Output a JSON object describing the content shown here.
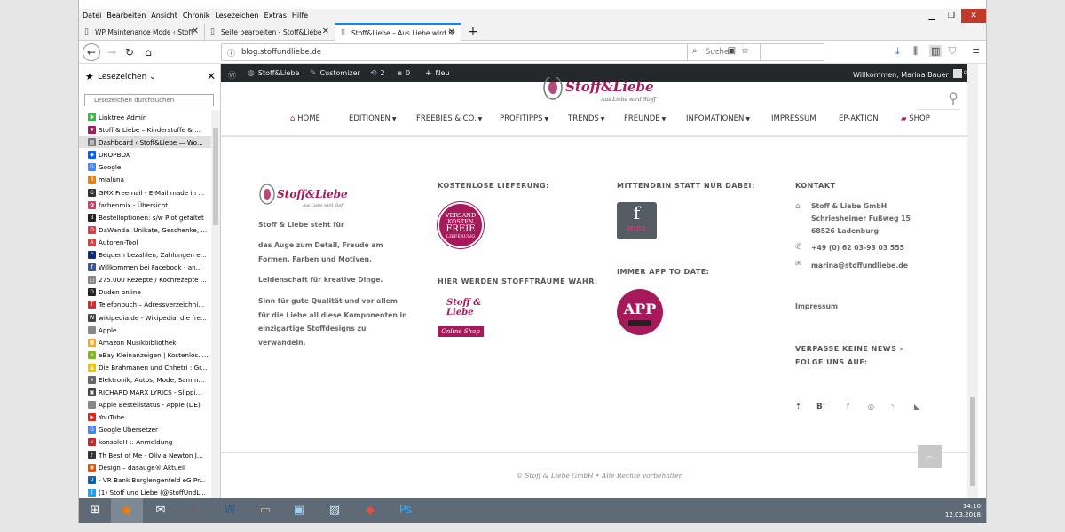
{
  "browser": {
    "menu": [
      "Datei",
      "Bearbeiten",
      "Ansicht",
      "Chronik",
      "Lesezeichen",
      "Extras",
      "Hilfe"
    ],
    "tabs": [
      {
        "label": "WP Maintenance Mode ‹ Stoff"
      },
      {
        "label": "Seite bearbeiten ‹ Stoff&Liebe"
      },
      {
        "label": "Stoff&Liebe – Aus Liebe wird St"
      }
    ],
    "url": "blog.stoffundliebe.de",
    "search_placeholder": "Suchen"
  },
  "sidebar": {
    "title": "Lesezeichen",
    "search_placeholder": "Lesezeichen durchsuchen",
    "bookmarks": [
      {
        "label": "Linktree Admin",
        "color": "#3bb54a",
        "glyph": "✱"
      },
      {
        "label": "Stoff & Liebe – Kinderstoffe & ...",
        "color": "#a6195a",
        "glyph": "❦"
      },
      {
        "label": "Dashboard ‹ Stoff&Liebe — Wo...",
        "color": "#777777",
        "glyph": "▤"
      },
      {
        "label": "DROPBOX",
        "color": "#0061ff",
        "glyph": "◆"
      },
      {
        "label": "Google",
        "color": "#4285f4",
        "glyph": "G"
      },
      {
        "label": "mialuna",
        "color": "#f57c00",
        "glyph": "B"
      },
      {
        "label": "GMX Freemail - E-Mail made in ...",
        "color": "#333333",
        "glyph": "G"
      },
      {
        "label": "farbenmix - Übersicht",
        "color": "#d83a6d",
        "glyph": "✿"
      },
      {
        "label": "Bestelloptionen: s/w Plot gefaltet",
        "color": "#222222",
        "glyph": "B"
      },
      {
        "label": "DaWanda: Unikate, Geschenke, ...",
        "color": "#e23744",
        "glyph": "D"
      },
      {
        "label": "Autoren-Tool",
        "color": "#e53935",
        "glyph": "A"
      },
      {
        "label": "Bequem bezahlen, Zahlungen e...",
        "color": "#003087",
        "glyph": "P"
      },
      {
        "label": "Willkommen bei Facebook - an...",
        "color": "#3b5998",
        "glyph": "f"
      },
      {
        "label": "275.000 Rezepte / Kochrezepte ...",
        "color": "#888888",
        "glyph": "▢"
      },
      {
        "label": "Duden online",
        "color": "#222222",
        "glyph": "D"
      },
      {
        "label": "Telefonbuch – Adressverzeichni...",
        "color": "#d32f2f",
        "glyph": "T"
      },
      {
        "label": "wikipedia.de - Wikipedia, die fre...",
        "color": "#444444",
        "glyph": "W"
      },
      {
        "label": "Apple",
        "color": "#888888",
        "glyph": ""
      },
      {
        "label": "Amazon Musikbibliothek",
        "color": "#f5a623",
        "glyph": "▦"
      },
      {
        "label": "eBay Kleinanzeigen | Kostenlos. ...",
        "color": "#86b817",
        "glyph": "e"
      },
      {
        "label": "Die Brahmanen und Chhetri : Gr...",
        "color": "#f2c200",
        "glyph": "▲"
      },
      {
        "label": "Elektronik, Autos, Mode, Samm...",
        "color": "#666666",
        "glyph": "e"
      },
      {
        "label": "RICHARD MARX LYRICS - Slippi...",
        "color": "#444444",
        "glyph": "▣"
      },
      {
        "label": "Apple Bestellstatus - Apple (DE)",
        "color": "#888888",
        "glyph": ""
      },
      {
        "label": "YouTube",
        "color": "#e62117",
        "glyph": "▶"
      },
      {
        "label": "Google Übersetzer",
        "color": "#4285f4",
        "glyph": "G"
      },
      {
        "label": "konsoleH :: Anmeldung",
        "color": "#c62828",
        "glyph": "k"
      },
      {
        "label": "Th Best of Me - Olivia Newton J...",
        "color": "#333333",
        "glyph": "♪"
      },
      {
        "label": "Design – dasauge® Aktuell",
        "color": "#e65100",
        "glyph": "◉"
      },
      {
        "label": "- VR Bank Burglengenfeld eG Pr...",
        "color": "#0066b3",
        "glyph": "V"
      },
      {
        "label": "(1) Stoff und Liebe (@StoffUndL...",
        "color": "#1da1f2",
        "glyph": "t"
      }
    ]
  },
  "admin_bar": {
    "site": "Stoff&Liebe",
    "customizer": "Customizer",
    "updates": "2",
    "comments": "0",
    "new": "Neu",
    "welcome": "Willkommen, Marina Bauer"
  },
  "site": {
    "logo_text": "Stoff&Liebe",
    "logo_tagline": "Aus Liebe wird Stoff",
    "nav": [
      "HOME",
      "EDITIONEN",
      "FREEBIES & CO.",
      "PROFITIPPS",
      "TRENDS",
      "FREUNDE",
      "INFOMATIONEN",
      "IMPRESSUM",
      "EP-AKTION",
      "SHOP"
    ]
  },
  "footer": {
    "col1": {
      "intro": "Stoff & Liebe steht für",
      "p1": "das Auge zum Detail, Freude am Formen, Farben und Motiven.",
      "p2": "Leidenschaft für kreative Dinge.",
      "p3": "Sinn für gute Qualität und vor allem für die Liebe all diese Komponenten in einzigartige Stoffdesigns zu verwandeln."
    },
    "col2": {
      "heading1": "KOSTENLOSE LIEFERUNG:",
      "badge_lines": [
        "VERSAND",
        "KOSTEN",
        "FREIE",
        "LIEFERUNG"
      ],
      "heading2": "HIER WERDEN STOFFTRÄUME WAHR:",
      "shop_logo": "Stoff & Liebe",
      "shop_label": "Online Shop"
    },
    "col3": {
      "heading1": "MITTENDRIN STATT NUR DABEI:",
      "mnz_label": "mnz",
      "heading2": "IMMER APP TO DATE:",
      "app_label": "APP"
    },
    "col4": {
      "heading": "KONTAKT",
      "company": "Stoff & Liebe GmbH",
      "street": "Schriesheimer Fußweg 15",
      "city": "68526 Ladenburg",
      "phone": "+49 (0) 62 03-93 03 555",
      "email": "marina@stoffundliebe.de",
      "impressum": "Impressum",
      "news1": "VERPASSE KEINE NEWS –",
      "news2": "FOLGE UNS AUF:"
    },
    "copyright": "© Stoff & Liebe GmbH • Alle Rechte vorbehalten"
  },
  "taskbar": {
    "time": "14:10",
    "date": "12.03.2018"
  }
}
